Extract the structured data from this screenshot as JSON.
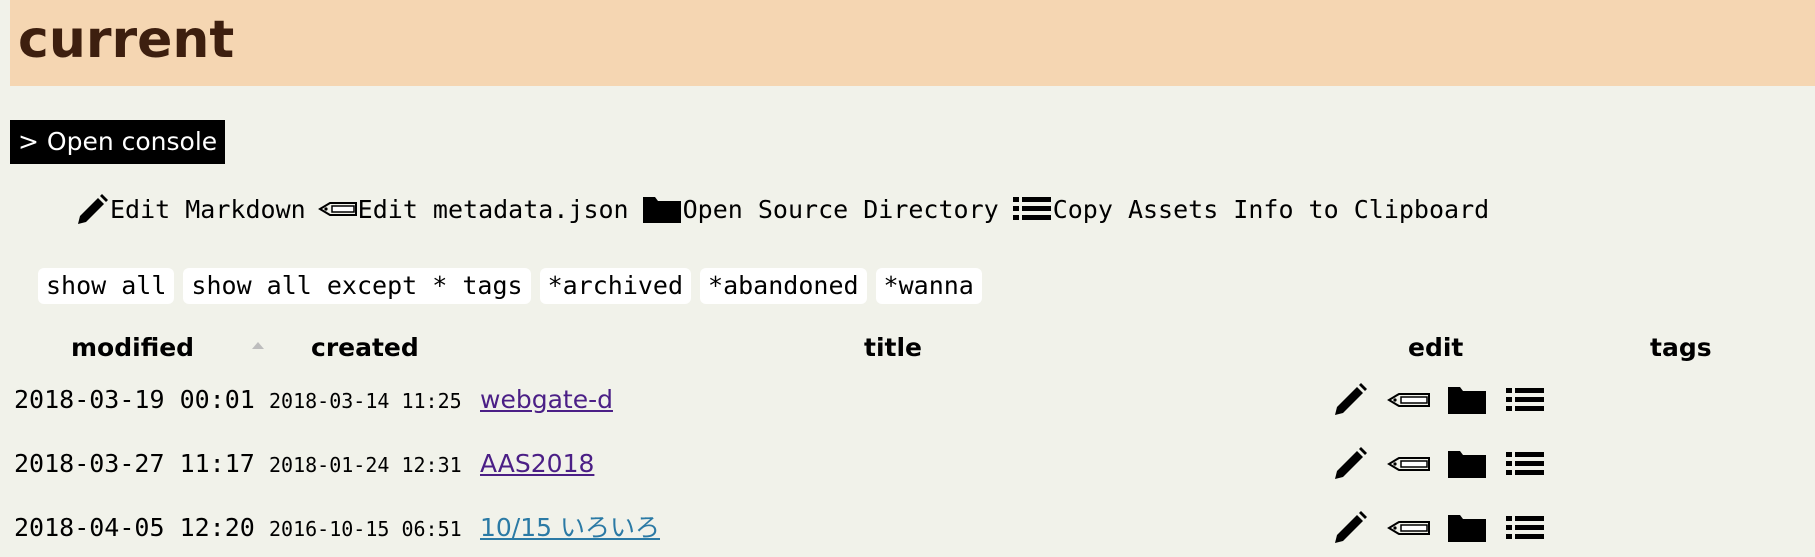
{
  "header": {
    "title": "current"
  },
  "console": {
    "label": "> Open console"
  },
  "actions": [
    {
      "icon": "pencil-icon",
      "label": "Edit Markdown"
    },
    {
      "icon": "tag-icon",
      "label": "Edit metadata.json"
    },
    {
      "icon": "folder-icon",
      "label": "Open Source Directory"
    },
    {
      "icon": "list-icon",
      "label": "Copy Assets Info to Clipboard"
    }
  ],
  "filters": [
    {
      "label": "show all"
    },
    {
      "label": "show all except * tags"
    },
    {
      "label": "*archived"
    },
    {
      "label": "*abandoned"
    },
    {
      "label": "*wanna"
    }
  ],
  "table": {
    "columns": {
      "modified": "modified",
      "created": "created",
      "title": "title",
      "edit": "edit",
      "tags": "tags"
    },
    "sort": {
      "column": "modified",
      "direction": "ascending"
    },
    "rows": [
      {
        "modified": "2018-03-19 00:01",
        "created": "2018-03-14 11:25",
        "title": "webgate-d",
        "visited": true
      },
      {
        "modified": "2018-03-27 11:17",
        "created": "2018-01-24 12:31",
        "title": "AAS2018",
        "visited": true
      },
      {
        "modified": "2018-04-05 12:20",
        "created": "2016-10-15 06:51",
        "title": "10/15 いろいろ",
        "visited": false
      }
    ]
  },
  "colors": {
    "background": "#f1f2ea",
    "header_bg": "#f5d6b2",
    "header_text": "#3d1f0f",
    "visited_link": "#4b1f86",
    "unvisited_link": "#2b7aa5"
  }
}
